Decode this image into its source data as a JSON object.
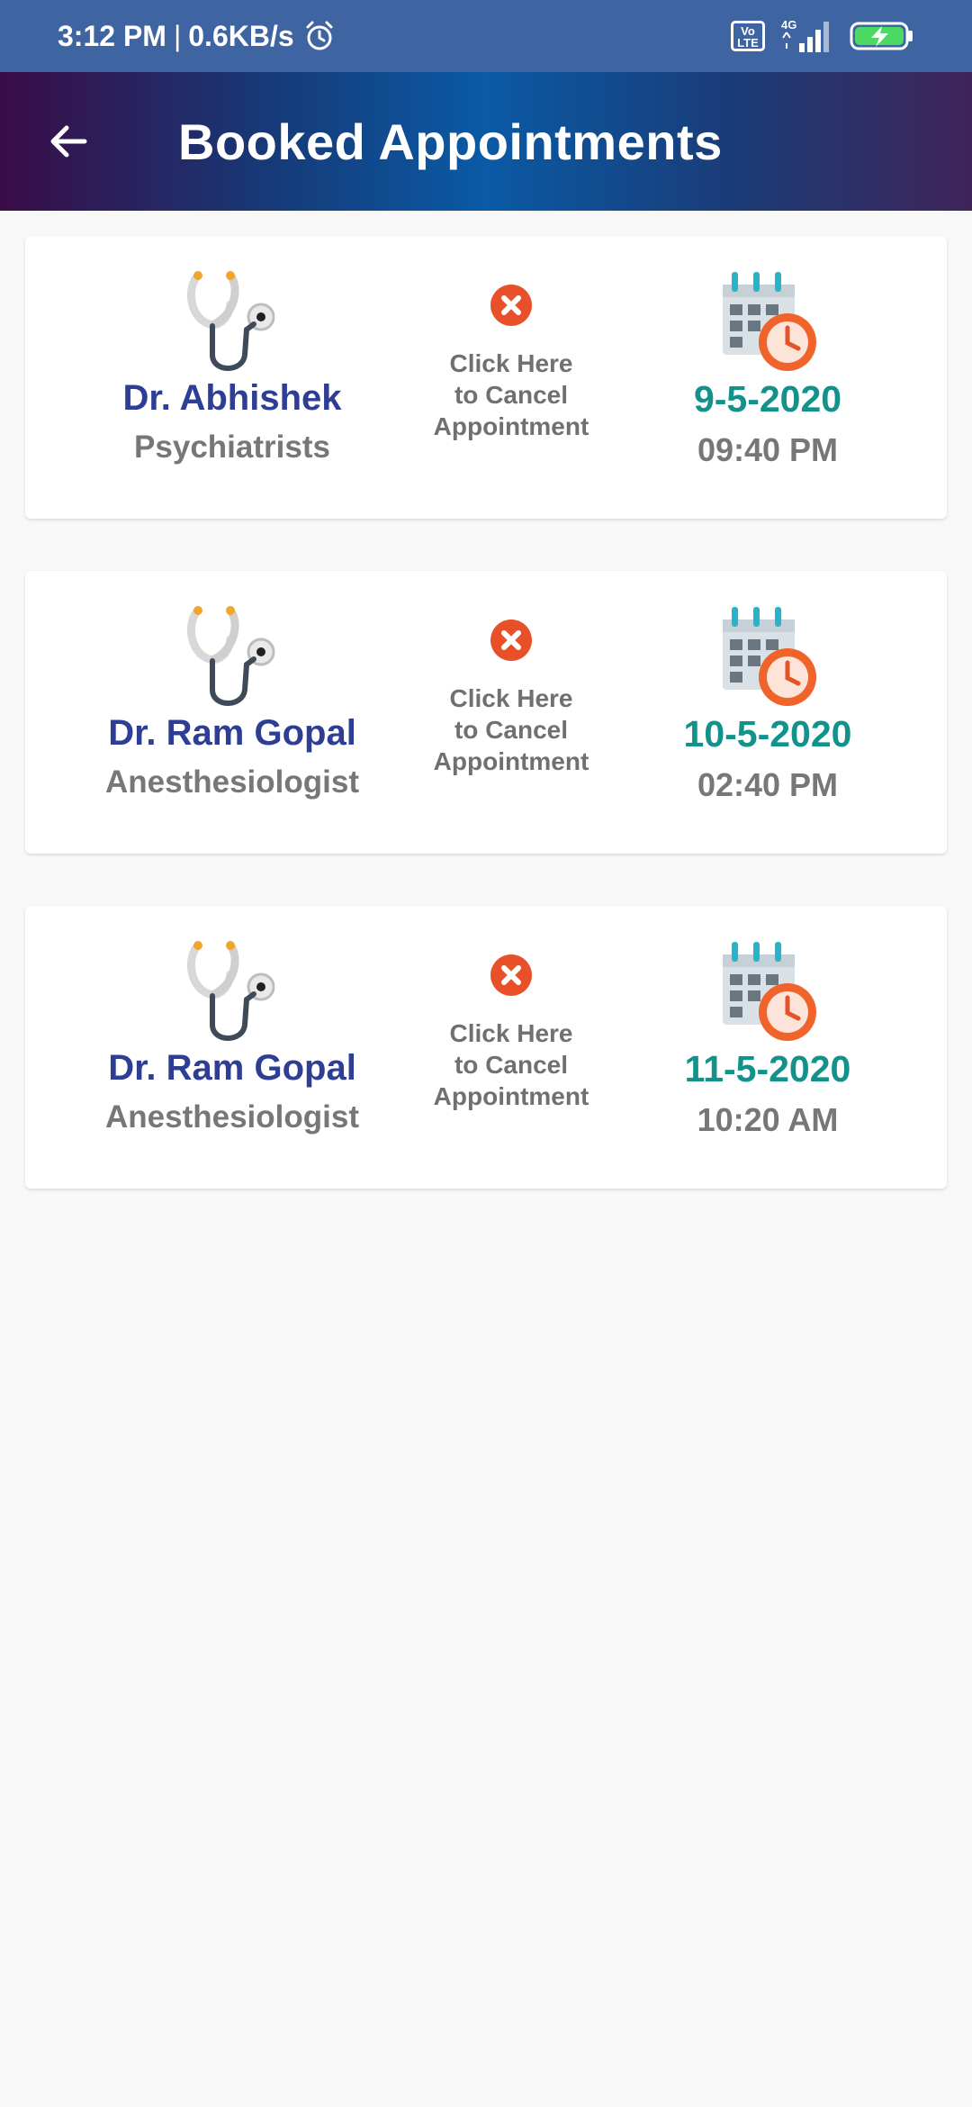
{
  "status_bar": {
    "time": "3:12 PM",
    "separator": "|",
    "speed": "0.6KB/s",
    "volte_top": "Vo",
    "volte_bottom": "LTE",
    "network": "4G",
    "icons": [
      "alarm-icon",
      "volte-icon",
      "signal-icon",
      "battery-charging-icon"
    ]
  },
  "app_bar": {
    "title": "Booked Appointments",
    "back_icon": "arrow-left-icon"
  },
  "colors": {
    "status_bar": "#3e64a1",
    "doctor_name": "#2d3e94",
    "date": "#12928a",
    "cancel": "#e8502a",
    "secondary_text": "#777777"
  },
  "appointments": [
    {
      "doctor": "Dr. Abhishek",
      "specialty": "Psychiatrists",
      "cancel_line1": "Click Here",
      "cancel_line2": "to Cancel",
      "cancel_line3": "Appointment",
      "date": "9-5-2020",
      "time": "09:40 PM"
    },
    {
      "doctor": "Dr. Ram Gopal",
      "specialty": "Anesthesiologist",
      "cancel_line1": "Click Here",
      "cancel_line2": "to Cancel",
      "cancel_line3": "Appointment",
      "date": "10-5-2020",
      "time": "02:40 PM"
    },
    {
      "doctor": "Dr. Ram Gopal",
      "specialty": "Anesthesiologist",
      "cancel_line1": "Click Here",
      "cancel_line2": "to Cancel",
      "cancel_line3": "Appointment",
      "date": "11-5-2020",
      "time": "10:20 AM"
    }
  ]
}
